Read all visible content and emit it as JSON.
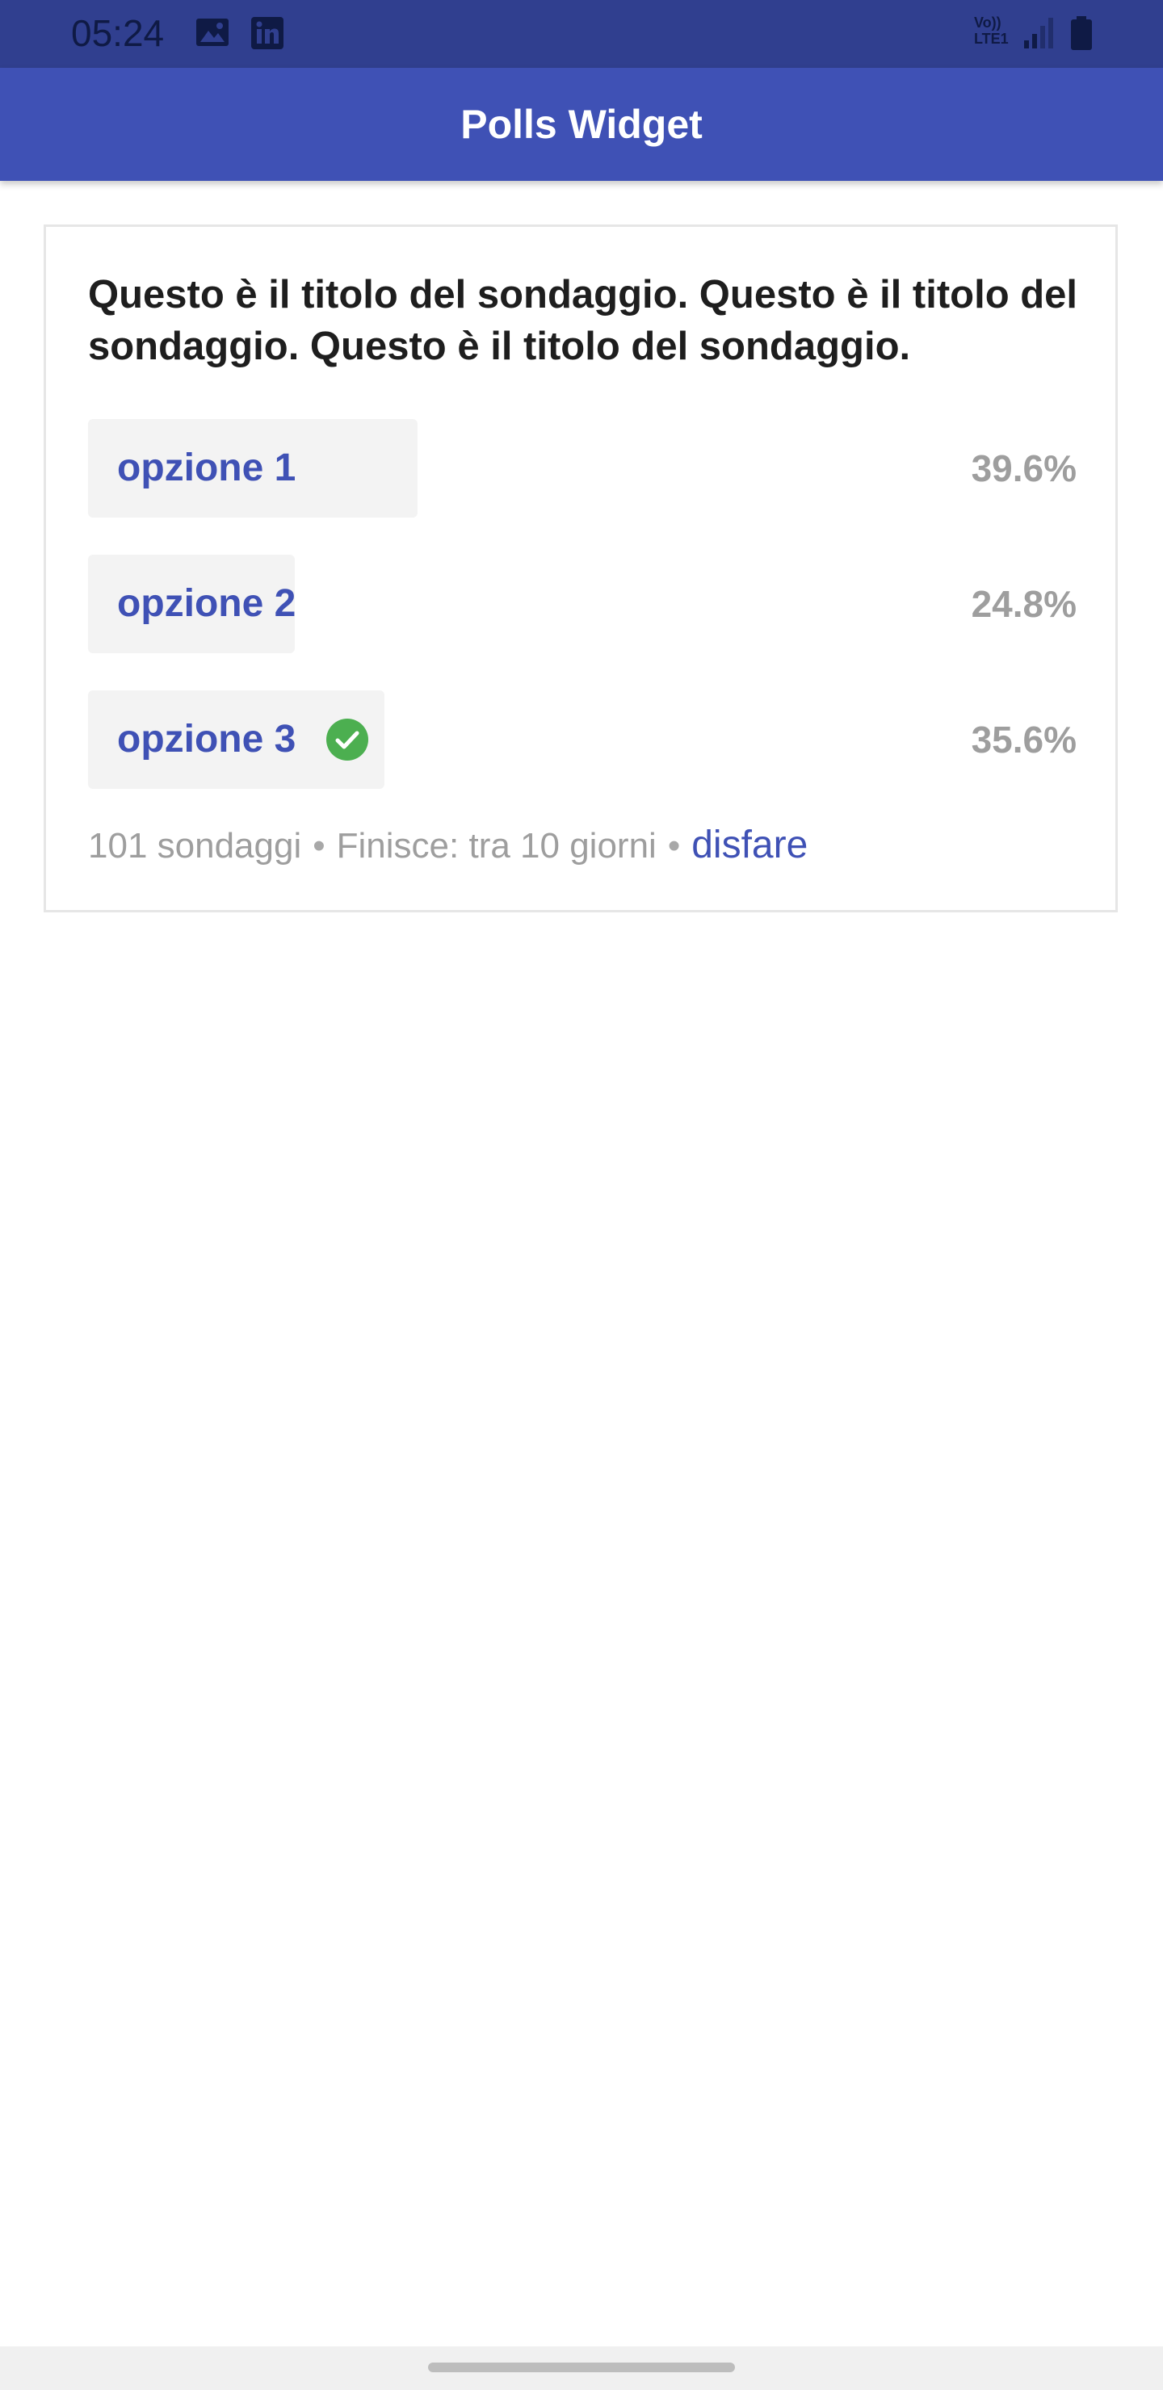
{
  "status_bar": {
    "time": "05:24",
    "icons": [
      "image-icon",
      "linkedin-icon",
      "signal-icon",
      "battery-icon"
    ],
    "network_line1": "Vo))",
    "network_line2": "LTE1"
  },
  "app_bar": {
    "title": "Polls Widget",
    "color": "#3f51b5"
  },
  "poll": {
    "question": "Questo è il titolo del sondaggio. Questo è il titolo del sondaggio. Questo è il titolo del sondaggio.",
    "options": [
      {
        "label": "opzione 1",
        "percent": "39.6%",
        "fraction": 0.396,
        "selected": false
      },
      {
        "label": "opzione 2",
        "percent": "24.8%",
        "fraction": 0.248,
        "selected": false
      },
      {
        "label": "opzione 3",
        "percent": "35.6%",
        "fraction": 0.356,
        "selected": true,
        "selected_icon": "check-circle-icon"
      }
    ],
    "footer": {
      "votes": "101 sondaggi",
      "separator": "•",
      "ends": "Finisce: tra 10 giorni",
      "undo": "disfare"
    },
    "colors": {
      "accent": "#3f51b5",
      "muted": "#9e9e9e",
      "check": "#4caf50",
      "bar": "#f3f3f3"
    }
  }
}
